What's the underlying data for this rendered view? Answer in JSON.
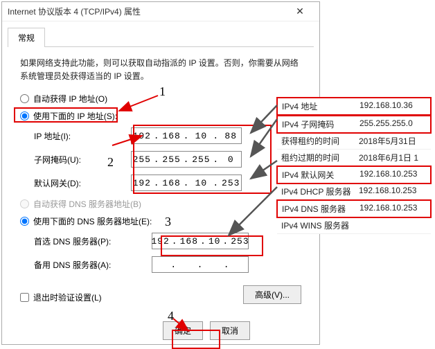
{
  "titlebar": {
    "title": "Internet 协议版本 4 (TCP/IPv4) 属性"
  },
  "tabs": {
    "general": "常规"
  },
  "description": "如果网络支持此功能，则可以获取自动指派的 IP 设置。否则，你需要从网络系统管理员处获得适当的 IP 设置。",
  "ip": {
    "auto_label": "自动获得 IP 地址(O)",
    "manual_label": "使用下面的 IP 地址(S):",
    "ip_label": "IP 地址(I):",
    "mask_label": "子网掩码(U):",
    "gw_label": "默认网关(D):",
    "ip_oct": [
      "192",
      "168",
      "10",
      "88"
    ],
    "mask_oct": [
      "255",
      "255",
      "255",
      "0"
    ],
    "gw_oct": [
      "192",
      "168",
      "10",
      "253"
    ]
  },
  "dns": {
    "auto_label": "自动获得 DNS 服务器地址(B)",
    "manual_label": "使用下面的 DNS 服务器地址(E):",
    "pref_label": "首选 DNS 服务器(P):",
    "alt_label": "备用 DNS 服务器(A):",
    "pref_oct": [
      "192",
      "168",
      "10",
      "253"
    ],
    "alt_oct": [
      "",
      "",
      "",
      ""
    ]
  },
  "validate_label": "退出时验证设置(L)",
  "buttons": {
    "advanced": "高级(V)...",
    "ok": "确定",
    "cancel": "取消"
  },
  "annotations": {
    "n1": "1",
    "n2": "2",
    "n3": "3",
    "n4": "4"
  },
  "info": [
    {
      "k": "IPv4 地址",
      "v": "192.168.10.36",
      "hl": true
    },
    {
      "k": "IPv4 子网掩码",
      "v": "255.255.255.0",
      "hl": true
    },
    {
      "k": "获得租约的时间",
      "v": "2018年5月31日",
      "hl": false
    },
    {
      "k": "租约过期的时间",
      "v": "2018年6月1日 1",
      "hl": false
    },
    {
      "k": "IPv4 默认网关",
      "v": "192.168.10.253",
      "hl": true
    },
    {
      "k": "IPv4 DHCP 服务器",
      "v": "192.168.10.253",
      "hl": false
    },
    {
      "k": "IPv4 DNS 服务器",
      "v": "192.168.10.253",
      "hl": true
    },
    {
      "k": "IPv4 WINS 服务器",
      "v": "",
      "hl": false
    }
  ]
}
